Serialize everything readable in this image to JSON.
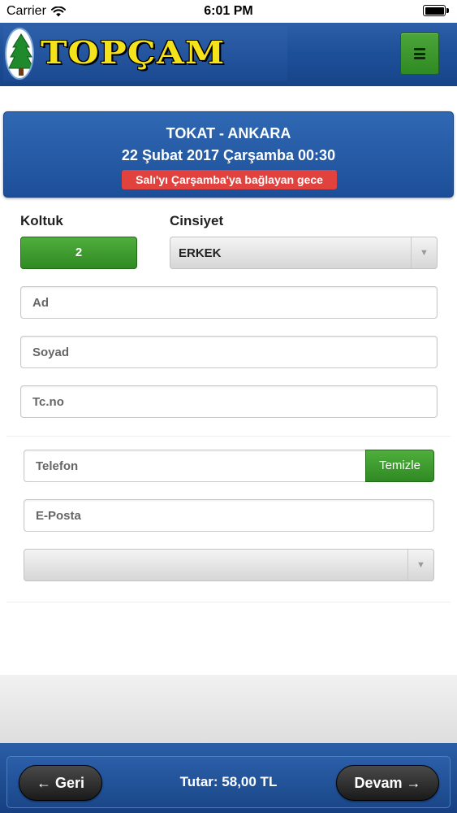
{
  "status_bar": {
    "carrier": "Carrier",
    "time": "6:01 PM"
  },
  "header": {
    "brand": "TOPÇAM",
    "menu_icon": "hamburger-menu-icon"
  },
  "trip": {
    "route": "TOKAT - ANKARA",
    "datetime": "22 Şubat 2017 Çarşamba 00:30",
    "note": "Salı'yı Çarşamba'ya bağlayan gece",
    "note_color": "#e2423e"
  },
  "passenger": {
    "seat_label": "Koltuk",
    "seat_number": "2",
    "gender_label": "Cinsiyet",
    "gender_value": "ERKEK",
    "first_name_placeholder": "Ad",
    "last_name_placeholder": "Soyad",
    "id_placeholder": "Tc.no"
  },
  "contact": {
    "phone_placeholder": "Telefon",
    "clear_label": "Temizle",
    "email_placeholder": "E-Posta",
    "extra_select_value": ""
  },
  "footer": {
    "back_label": "← Geri",
    "total_label": "Tutar: 58,00 TL",
    "next_label": "Devam →"
  },
  "colors": {
    "brand_blue": "#1d4f99",
    "action_green": "#2f8a23",
    "logo_yellow": "#f4e21b"
  }
}
